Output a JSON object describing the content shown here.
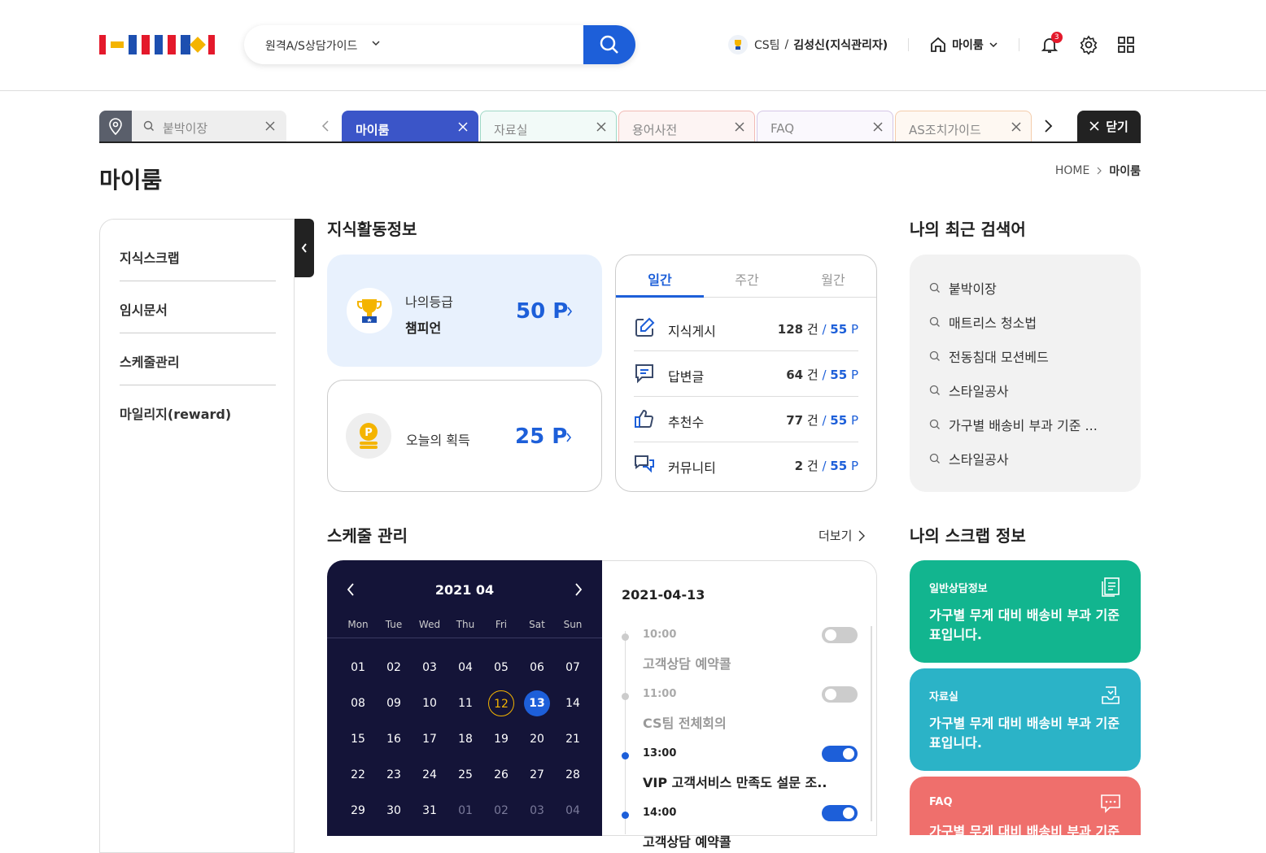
{
  "header": {
    "search_text": "원격A/S상담가이드",
    "team": "CS팀",
    "slash": "/",
    "user": "김성신(지식관리자)",
    "myroom_label": "마이룸",
    "notif_count": "3"
  },
  "tabbar": {
    "quick_search": "붙박이장",
    "tabs": [
      {
        "label": "마이룸",
        "active": true,
        "border": "#3b55c8",
        "bg": "#3b55c8"
      },
      {
        "label": "자료실",
        "border": "#9fd8c6",
        "bg": "#f2faf8"
      },
      {
        "label": "용어사전",
        "border": "#f1b9b4",
        "bg": "#fdf4f3"
      },
      {
        "label": "FAQ",
        "border": "#d4c6e6",
        "bg": "#faf8fd"
      },
      {
        "label": "AS조치가이드",
        "border": "#f4ccab",
        "bg": "#fef8f2"
      }
    ],
    "close_label": "닫기"
  },
  "page": {
    "title": "마이룸",
    "crumb_home": "HOME",
    "crumb_current": "마이룸"
  },
  "sidebar": {
    "items": [
      "지식스크랩",
      "임시문서",
      "스케줄관리",
      "마일리지(reward)"
    ]
  },
  "activity": {
    "title": "지식활동정보",
    "grade_label": "나의등급",
    "grade_value": "챔피언",
    "grade_points": "50 P",
    "today_label": "오늘의 획득",
    "today_points": "25 P",
    "period_tabs": [
      "일간",
      "주간",
      "월간"
    ],
    "stats": [
      {
        "label": "지식게시",
        "count": "128",
        "points": "55"
      },
      {
        "label": "답변글",
        "count": "64",
        "points": "55"
      },
      {
        "label": "추천수",
        "count": "77",
        "points": "55"
      },
      {
        "label": "커뮤니티",
        "count": "2",
        "points": "55"
      }
    ],
    "count_unit": "건",
    "sep": "/",
    "point_unit": "P"
  },
  "recent": {
    "title": "나의 최근 검색어",
    "items": [
      "붙박이장",
      "매트리스 청소법",
      "전동침대 모션베드",
      "스타일공사",
      "가구별 배송비 부과 기준 ...",
      "스타일공사"
    ]
  },
  "schedule": {
    "title": "스케줄 관리",
    "more": "더보기",
    "month": "2021 04",
    "dow": [
      "Mon",
      "Tue",
      "Wed",
      "Thu",
      "Fri",
      "Sat",
      "Sun"
    ],
    "weeks": [
      [
        "01",
        "02",
        "03",
        "04",
        "05",
        "06",
        "07"
      ],
      [
        "08",
        "09",
        "10",
        "11",
        "12",
        "13",
        "14"
      ],
      [
        "15",
        "16",
        "17",
        "18",
        "19",
        "20",
        "21"
      ],
      [
        "22",
        "23",
        "24",
        "25",
        "26",
        "27",
        "28"
      ],
      [
        "29",
        "30",
        "31",
        "01",
        "02",
        "03",
        "04"
      ]
    ],
    "today": "12",
    "selected": "13",
    "date": "2021-04-13",
    "events": [
      {
        "time": "10:00",
        "title": "고객상담 예약콜",
        "on": false
      },
      {
        "time": "11:00",
        "title": "CS팀 전체회의",
        "on": false
      },
      {
        "time": "13:00",
        "title": "VIP 고객서비스 만족도 설문 조..",
        "on": true
      },
      {
        "time": "14:00",
        "title": "고객상담 예약콜",
        "on": true
      }
    ]
  },
  "scrap": {
    "title": "나의 스크랩 정보",
    "cards": [
      {
        "label": "일반상담정보",
        "desc": "가구별 무게 대비 배송비 부과 기준표입니다.",
        "color": "#12b58f"
      },
      {
        "label": "자료실",
        "desc": "가구별 무게 대비 배송비 부과 기준표입니다.",
        "color": "#2bb3c7"
      },
      {
        "label": "FAQ",
        "desc": "가구별 무게 대비 배송비 부과 기준표입니다.",
        "color": "#ef6f6c"
      }
    ]
  }
}
